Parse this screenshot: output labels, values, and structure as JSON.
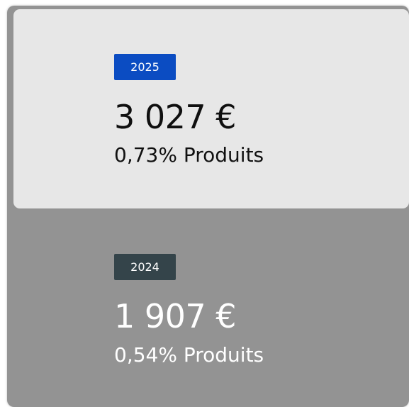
{
  "cards": [
    {
      "year": "2025",
      "amount": "3 027 €",
      "subtitle": "0,73% Produits",
      "badge_color": "#0b4cc2"
    },
    {
      "year": "2024",
      "amount": "1 907 €",
      "subtitle": "0,54% Produits",
      "badge_color": "#34444a"
    }
  ],
  "colors": {
    "outer_panel": "#939393",
    "inner_panel": "#e7e7e7"
  }
}
